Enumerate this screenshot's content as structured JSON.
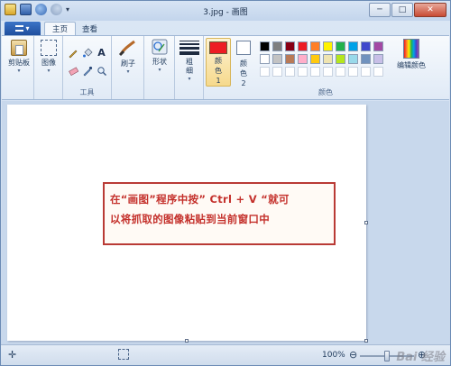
{
  "window": {
    "title": "3.jpg - 画图",
    "controls": {
      "minimize": "─",
      "maximize": "□",
      "close": "✕"
    }
  },
  "quick_access": {
    "icons": [
      "save-icon",
      "undo-icon",
      "redo-icon",
      "customize-dropdown-icon"
    ]
  },
  "tabs": {
    "app_menu_label": "▾",
    "items": [
      {
        "label": "主页",
        "active": true
      },
      {
        "label": "查看",
        "active": false
      }
    ]
  },
  "ribbon": {
    "clipboard": {
      "paste_label": "剪贴板",
      "caret": "▾"
    },
    "image": {
      "label": "图像",
      "caret": "▾"
    },
    "tools": {
      "group_label": "工具",
      "text_tool": "A"
    },
    "brushes": {
      "label": "刷子",
      "caret": "▾"
    },
    "shapes": {
      "label": "形状",
      "caret": "▾"
    },
    "size": {
      "label": "粗细",
      "caret": "▾"
    },
    "color1": {
      "label": "颜色 1",
      "value": "#ed1c24"
    },
    "color2": {
      "label": "颜色 2",
      "value": "#ffffff"
    },
    "colors": {
      "group_label": "颜色",
      "row1": [
        "#000000",
        "#7f7f7f",
        "#880015",
        "#ed1c24",
        "#ff7f27",
        "#fff200",
        "#22b14c",
        "#00a2e8",
        "#3f48cc",
        "#a349a4"
      ],
      "row2": [
        "#ffffff",
        "#c3c3c3",
        "#b97a57",
        "#ffaec9",
        "#ffc90e",
        "#efe4b0",
        "#b5e61d",
        "#99d9ea",
        "#7092be",
        "#c8bfe7"
      ]
    },
    "edit_colors": {
      "label": "编辑颜色"
    }
  },
  "canvas": {
    "callout_line1": "在“画图”程序中按” Ctrl + V “就可",
    "callout_line2": "以将抓取的图像粘贴到当前窗口中",
    "callout_border_color": "#b93a35",
    "callout_text_color": "#c4302b"
  },
  "statusbar": {
    "add_icon": "✛",
    "zoom_label": "100%",
    "zoom_minus": "⊖",
    "zoom_plus": "⊕",
    "zoom_fraction": 0.5,
    "watermark": "Bai 经验"
  }
}
